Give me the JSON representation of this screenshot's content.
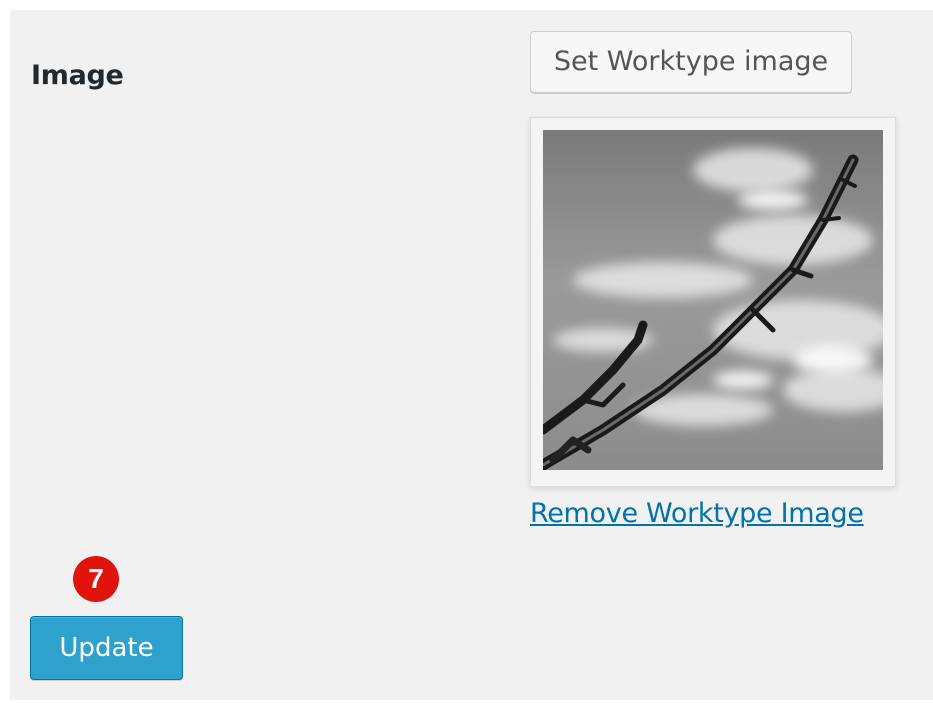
{
  "field": {
    "label": "Image"
  },
  "actions": {
    "set_image_label": "Set Worktype image",
    "remove_image_label": "Remove Worktype Image",
    "update_label": "Update"
  },
  "annotation": {
    "step_number": "7",
    "badge_color": "#e0140d"
  },
  "colors": {
    "panel_background": "#f1f1f1",
    "primary_button": "#2ea2cc",
    "link": "#0073aa"
  },
  "image": {
    "icon": "photo-thumbnail-icon",
    "style": "grayscale"
  }
}
